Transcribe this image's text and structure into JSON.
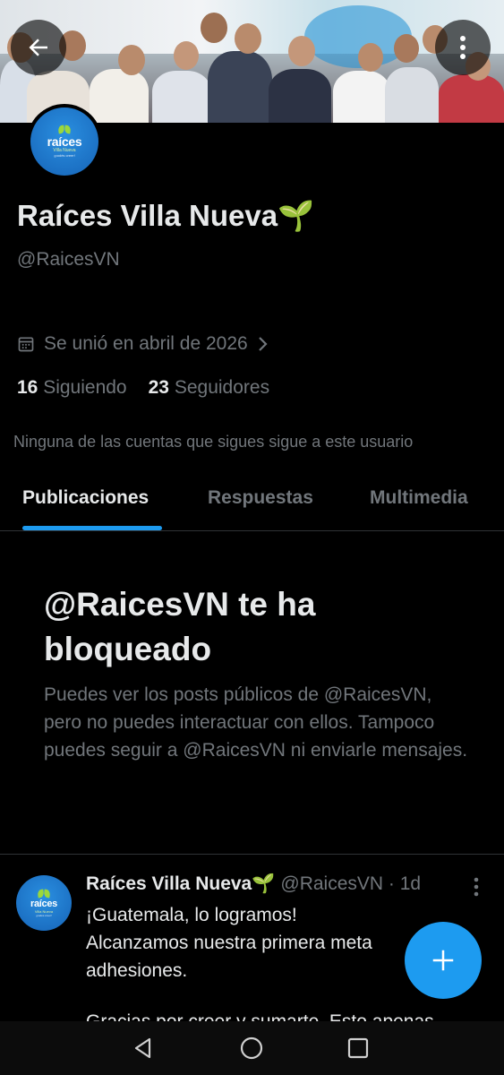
{
  "profile": {
    "display_name": "Raíces Villa Nueva🌱",
    "handle": "@RaicesVN",
    "joined": "Se unió en abril de 2026",
    "following_count": "16",
    "following_label": "Siguiendo",
    "followers_count": "23",
    "followers_label": "Seguidores",
    "mutual_note": "Ninguna de las cuentas que sigues sigue a este usuario"
  },
  "logo": {
    "main": "raíces",
    "sub": "Villa Nueva",
    "tag": "¡podés creer!"
  },
  "tabs": [
    {
      "label": "Publicaciones",
      "active": true
    },
    {
      "label": "Respuestas",
      "active": false
    },
    {
      "label": "Multimedia",
      "active": false
    }
  ],
  "blocked": {
    "title": "@RaicesVN te ha bloqueado",
    "description": "Puedes ver los posts públicos de @RaicesVN, pero no puedes interactuar con ellos. Tampoco puedes seguir a @RaicesVN ni enviarle mensajes."
  },
  "post": {
    "author": "Raíces Villa Nueva🌱",
    "handle_time": "@RaicesVN · 1d",
    "line1": "¡Guatemala, lo logramos!",
    "line2": "Alcanzamos nuestra primera meta",
    "line3": "adhesiones.",
    "line_cut": "Gracias por creer y sumarte. Esto apenas"
  },
  "icons": {
    "back": "arrow-left-icon",
    "more": "more-vertical-icon",
    "calendar": "calendar-icon",
    "chevron": "chevron-right-icon",
    "compose": "plus-icon",
    "nav_back": "triangle-back-icon",
    "nav_home": "circle-home-icon",
    "nav_recents": "square-recents-icon"
  },
  "colors": {
    "accent": "#1d9bf0",
    "background": "#000000",
    "secondary_text": "#71767b"
  }
}
